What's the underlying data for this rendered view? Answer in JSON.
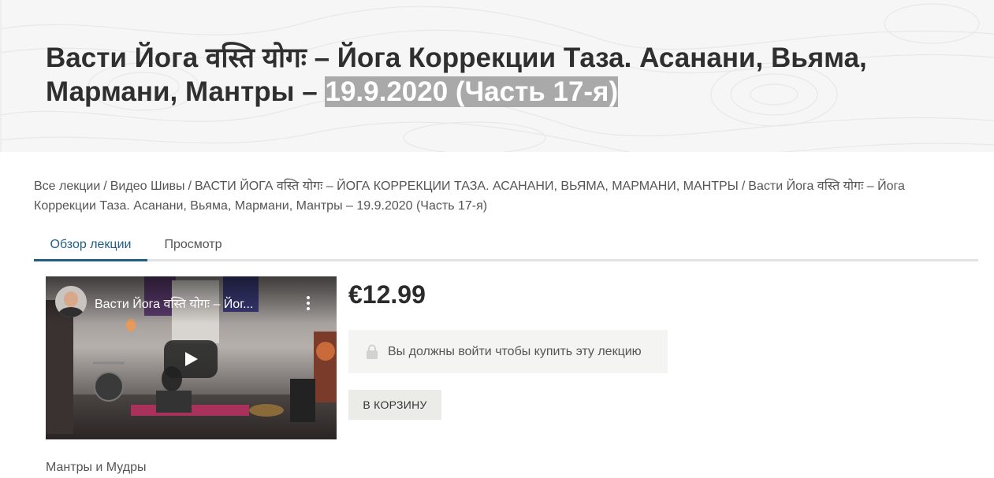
{
  "hero": {
    "title_main": "Васти Йога वस्ति योगः – Йога Коррекции Таза. Асанани, Вьяма, Мармани, Мантры – ",
    "title_highlight": "19.9.2020 (Часть 17-я)"
  },
  "breadcrumb": {
    "items": [
      "Все лекции",
      "Видео Шивы",
      "ВАСТИ ЙОГА वस्ति योगः – ЙОГА КОРРЕКЦИИ ТАЗА. АСАНАНИ, ВЬЯМА, МАРМАНИ, МАНТРЫ",
      "Васти Йога वस्ति योगः – Йога Коррекции Таза. Асанани, Вьяма, Мармани, Мантры – 19.9.2020 (Часть 17-я)"
    ],
    "separator": "/"
  },
  "tabs": [
    {
      "label": "Обзор лекции",
      "active": true
    },
    {
      "label": "Просмотр",
      "active": false
    }
  ],
  "video": {
    "title": "Васти Йога वस्ति योगः – Йог...",
    "play_icon": "play-icon",
    "menu_icon": "kebab-menu-icon"
  },
  "product": {
    "price": "€12.99",
    "login_notice": "Вы должны войти чтобы купить эту лекцию",
    "lock_icon": "lock-icon",
    "add_to_cart_label": "В КОРЗИНУ"
  },
  "category": "Мантры и Мудры",
  "colors": {
    "accent": "#1f5f86",
    "highlight_bg": "#a9a9a9",
    "hero_bg": "#f6f6f6"
  }
}
